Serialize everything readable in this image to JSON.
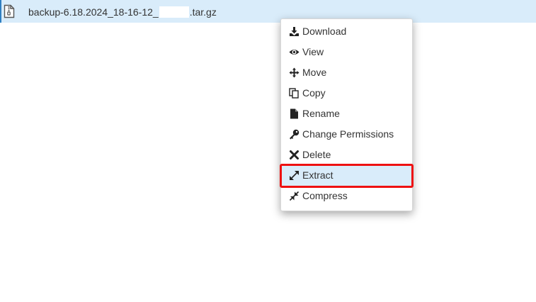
{
  "file": {
    "name_prefix": "backup-6.18.2024_18-16-12_",
    "name_suffix": ".tar.gz",
    "icon": "archive-file-icon"
  },
  "context_menu": {
    "items": [
      {
        "label": "Download",
        "icon": "download-icon"
      },
      {
        "label": "View",
        "icon": "eye-icon"
      },
      {
        "label": "Move",
        "icon": "move-arrows-icon"
      },
      {
        "label": "Copy",
        "icon": "copy-icon"
      },
      {
        "label": "Rename",
        "icon": "file-icon"
      },
      {
        "label": "Change Permissions",
        "icon": "key-icon"
      },
      {
        "label": "Delete",
        "icon": "x-icon"
      },
      {
        "label": "Extract",
        "icon": "expand-icon",
        "highlighted": true
      },
      {
        "label": "Compress",
        "icon": "compress-icon"
      }
    ]
  },
  "colors": {
    "row_selected": "#d9ecfa",
    "annotation_box": "#ee1111",
    "text": "#333333"
  }
}
